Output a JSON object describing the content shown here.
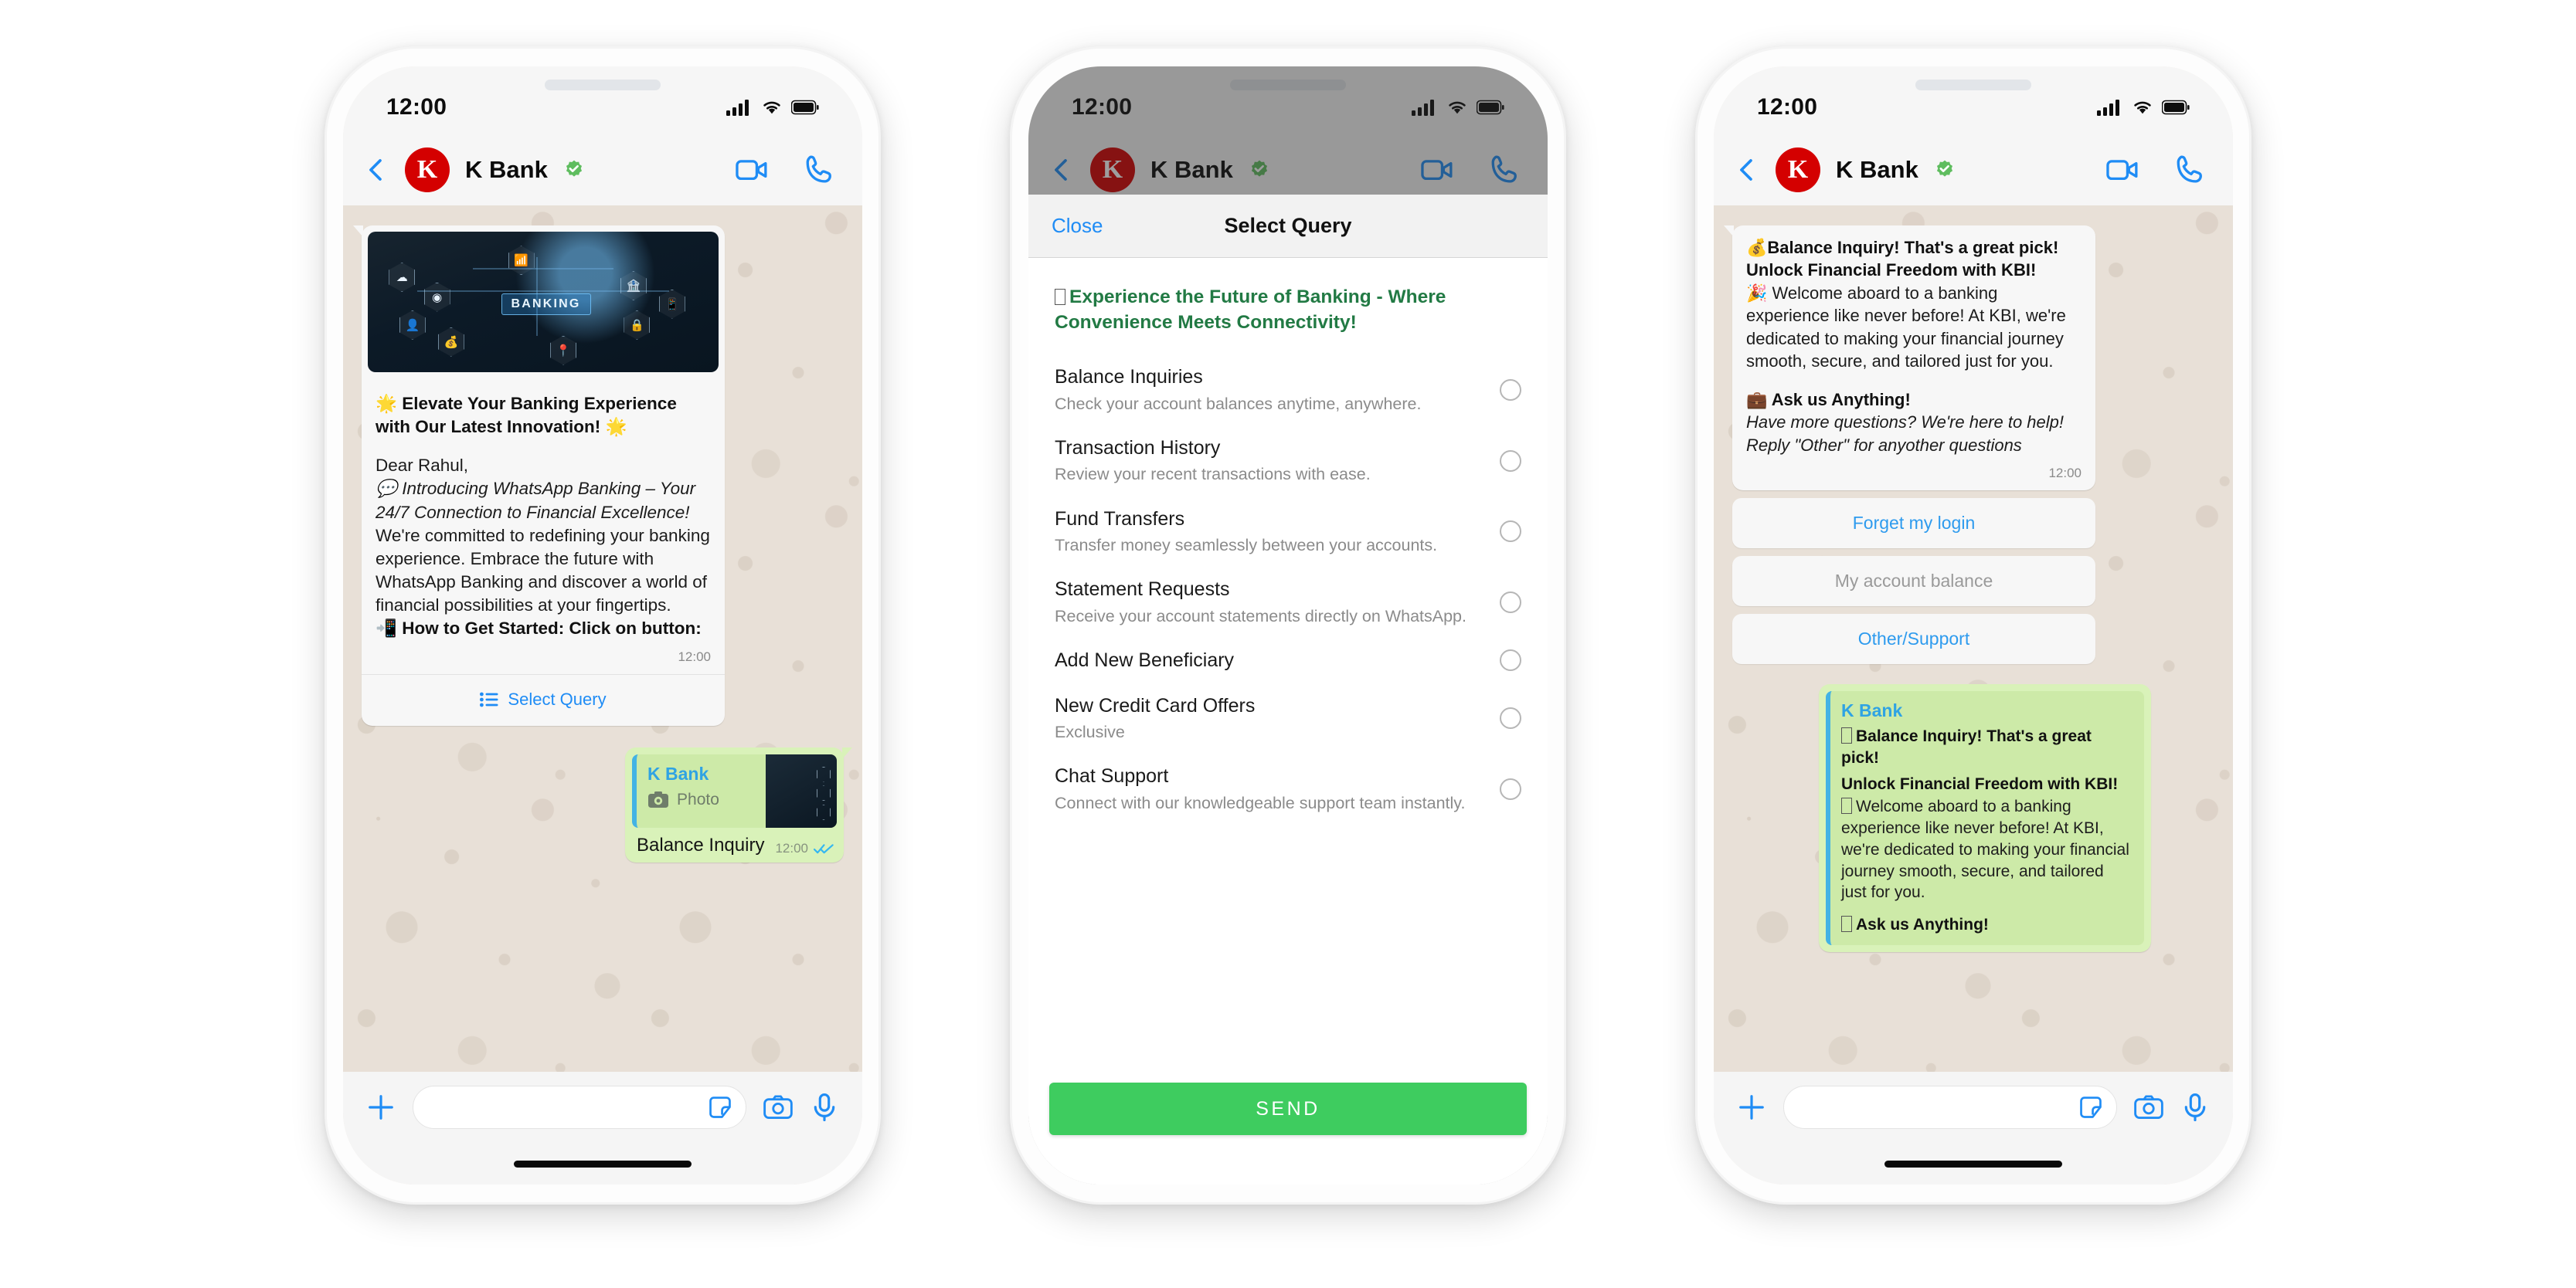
{
  "brand": {
    "accent_blue": "#1f8cf5",
    "whatsapp_green": "#3ecc5f",
    "avatar_red": "#d40000",
    "bubble_out_green": "#d9f2b9",
    "lead_green": "#227a44"
  },
  "status_bar": {
    "time": "12:00"
  },
  "chat_header": {
    "contact_name": "K Bank",
    "avatar_initial": "K",
    "verified": true
  },
  "phone1": {
    "message": {
      "image_label": "BANKING",
      "heading": "🌟 Elevate Your Banking Experience with Our Latest Innovation! 🌟",
      "greeting": "Dear Rahul,",
      "tagline": "💬 Introducing WhatsApp Banking – Your 24/7 Connection to Financial Excellence!",
      "body": "We're committed to redefining your banking experience. Embrace the future with WhatsApp Banking and discover a world of financial possibilities at your fingertips.",
      "cta_line": "📲 How to Get Started: Click on button:",
      "time": "12:00",
      "button_label": "Select Query"
    },
    "reply": {
      "quote_name": "K Bank",
      "quote_kind": "Photo",
      "text": "Balance Inquiry",
      "time": "12:00",
      "status": "read"
    },
    "input": {
      "placeholder": ""
    }
  },
  "phone2": {
    "sheet": {
      "close_label": "Close",
      "title": "Select Query",
      "lead": "Experience the Future of Banking - Where Convenience Meets Connectivity!",
      "send_label": "SEND",
      "items": [
        {
          "title": "Balance Inquiries",
          "desc": "Check your account balances anytime, anywhere.",
          "selected": false
        },
        {
          "title": "Transaction History",
          "desc": "Review your recent transactions with ease.",
          "selected": false
        },
        {
          "title": "Fund Transfers",
          "desc": "Transfer money seamlessly between your accounts.",
          "selected": false
        },
        {
          "title": "Statement Requests",
          "desc": "Receive your account statements directly on WhatsApp.",
          "selected": false
        },
        {
          "title": "Add New Beneficiary",
          "desc": "",
          "selected": false
        },
        {
          "title": "New Credit Card Offers",
          "desc": "Exclusive",
          "selected": false
        },
        {
          "title": "Chat Support",
          "desc": "Connect with our knowledgeable support team instantly.",
          "selected": false
        }
      ]
    }
  },
  "phone3": {
    "message": {
      "line1": "💰Balance Inquiry! That's a great pick!",
      "line2": "Unlock Financial Freedom with KBI!",
      "line3": "🎉 Welcome aboard to a banking experience like never before! At KBI, we're dedicated to making your financial journey smooth, secure, and tailored just for you.",
      "line4": "💼 Ask us Anything!",
      "line5": "Have more questions? We're here to help!",
      "line6": "Reply \"Other\" for anyother questions",
      "time": "12:00"
    },
    "quick_replies": [
      {
        "label": "Forget my login",
        "muted": false
      },
      {
        "label": "My account balance",
        "muted": true
      },
      {
        "label": "Other/Support",
        "muted": false
      }
    ],
    "echo": {
      "name": "K Bank",
      "b1": "Balance Inquiry! That's a great pick!",
      "b2": "Unlock Financial Freedom with KBI!",
      "p1": "Welcome aboard to a banking experience like never before! At KBI, we're dedicated to making your financial journey smooth, secure, and tailored just for you.",
      "b3": "Ask us Anything!"
    }
  }
}
